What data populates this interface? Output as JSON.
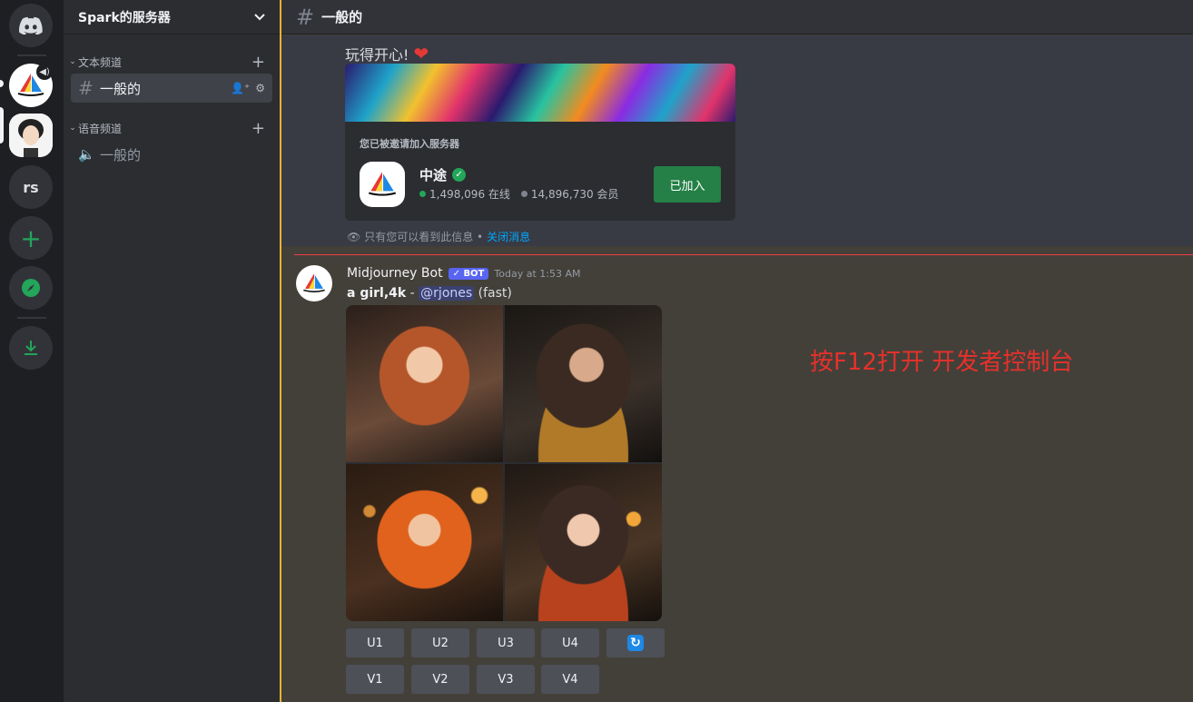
{
  "server": {
    "name": "Spark的服务器",
    "rail_items": [
      {
        "name": "home",
        "icon": "discord-logo-icon"
      },
      {
        "name": "midjourney",
        "icon": "sailboat-icon"
      },
      {
        "name": "avatar-server",
        "icon": "avatar"
      },
      {
        "name": "rs",
        "label": "rs"
      },
      {
        "name": "add-server",
        "icon": "plus-icon",
        "label": "+"
      },
      {
        "name": "explore",
        "icon": "compass-icon"
      },
      {
        "name": "download",
        "icon": "download-icon"
      }
    ]
  },
  "sidebar": {
    "categories": [
      {
        "label": "文本频道",
        "channels": [
          {
            "label": "一般的",
            "type": "text",
            "active": true
          }
        ]
      },
      {
        "label": "语音频道",
        "channels": [
          {
            "label": "一般的",
            "type": "voice",
            "active": false
          }
        ]
      }
    ]
  },
  "channel": {
    "hash": "#",
    "name": "一般的"
  },
  "invite_message": {
    "text": "玩得开心!",
    "heart": "❤",
    "invite_title": "您已被邀请加入服务器",
    "server_name": "中途",
    "online": "1,498,096 在线",
    "members": "14,896,730 会员",
    "joined_label": "已加入",
    "only_you_text": "只有您可以看到此信息 •",
    "dismiss_link": "关闭消息"
  },
  "bot_message": {
    "author": "Midjourney Bot",
    "bot_tag": "✓ BOT",
    "timestamp": "Today at 1:53 AM",
    "prompt": "a girl,4k",
    "separator": " - ",
    "mention": "@rjones",
    "mode": " (fast)",
    "upscale_buttons": [
      "U1",
      "U2",
      "U3",
      "U4"
    ],
    "variation_buttons": [
      "V1",
      "V2",
      "V3",
      "V4"
    ],
    "reroll_icon": "↻"
  },
  "annotation": "按F12打开 开发者控制台",
  "colors": {
    "accent_green": "#23a55a",
    "blurple": "#5865f2",
    "link": "#00a8fc",
    "annotation_red": "#e8302a",
    "highlight_bar": "#f0b232"
  }
}
